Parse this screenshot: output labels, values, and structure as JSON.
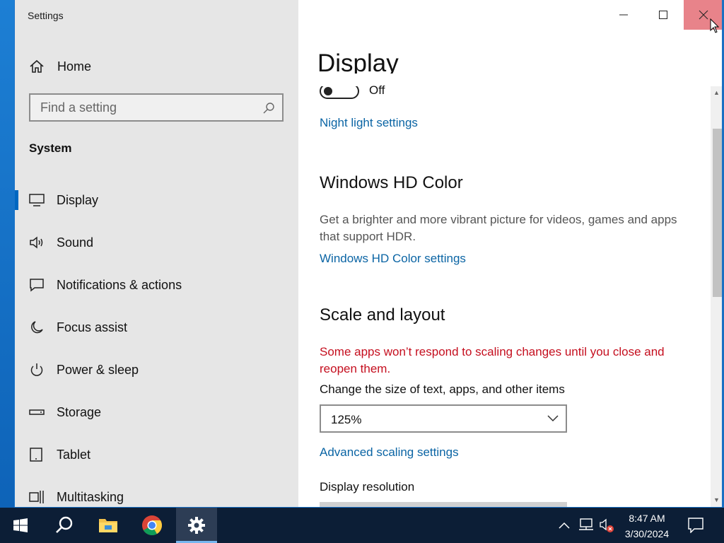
{
  "window": {
    "title": "Settings"
  },
  "sidebar": {
    "home_label": "Home",
    "search_placeholder": "Find a setting",
    "section_title": "System",
    "items": [
      {
        "label": "Display",
        "icon": "monitor-icon",
        "active": true
      },
      {
        "label": "Sound",
        "icon": "speaker-icon"
      },
      {
        "label": "Notifications & actions",
        "icon": "notification-icon"
      },
      {
        "label": "Focus assist",
        "icon": "moon-icon"
      },
      {
        "label": "Power & sleep",
        "icon": "power-icon"
      },
      {
        "label": "Storage",
        "icon": "storage-icon"
      },
      {
        "label": "Tablet",
        "icon": "tablet-icon"
      },
      {
        "label": "Multitasking",
        "icon": "multitasking-icon"
      }
    ]
  },
  "main": {
    "title": "Display",
    "night_light": {
      "state": "Off",
      "settings_link": "Night light settings"
    },
    "hdr": {
      "heading": "Windows HD Color",
      "description": "Get a brighter and more vibrant picture for videos, games and apps that support HDR.",
      "settings_link": "Windows HD Color settings"
    },
    "scale": {
      "heading": "Scale and layout",
      "warning": "Some apps won’t respond to scaling changes until you close and reopen them.",
      "size_label": "Change the size of text, apps, and other items",
      "size_value": "125%",
      "advanced_link": "Advanced scaling settings",
      "resolution_label": "Display resolution"
    }
  },
  "taskbar": {
    "time": "8:47 AM",
    "date": "3/30/2024",
    "apps": [
      "windows-start-icon",
      "search-icon",
      "file-explorer-icon",
      "chrome-icon",
      "settings-gear-icon"
    ]
  },
  "colors": {
    "link": "#0a64a4",
    "warning": "#c50f1f",
    "accent": "#0067c0",
    "close_hover": "#e8838a"
  }
}
